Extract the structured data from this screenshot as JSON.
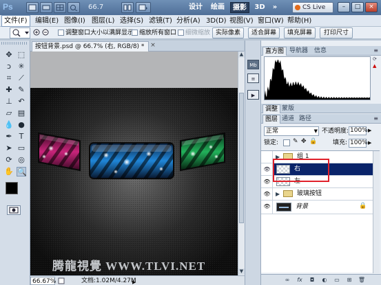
{
  "titlebar": {
    "app_logo": "Ps",
    "zoom_value": "66.7",
    "workspaces": [
      "设计",
      "绘画",
      "摄影",
      "3D"
    ],
    "active_workspace": "摄影",
    "more_label": "»",
    "cs_live": "CS Live",
    "win_minimize": "–",
    "win_restore": "□",
    "win_close": "×"
  },
  "menu": [
    "文件(F)",
    "编辑(E)",
    "图像(I)",
    "图层(L)",
    "选择(S)",
    "滤镜(T)",
    "分析(A)",
    "3D(D)",
    "视图(V)",
    "窗口(W)",
    "帮助(H)"
  ],
  "options": {
    "resize_windows": "调整窗口大小以满屏显示",
    "zoom_all": "缩放所有窗口",
    "scrubby_zoom": "细微缩放",
    "actual_pixels": "实际像素",
    "fit_screen": "适合屏幕",
    "fill_screen": "填充屏幕",
    "print_size": "打印尺寸"
  },
  "document": {
    "tab_title": "按钮背景.psd @ 66.7% (右, RGB/8) *",
    "close": "×",
    "watermark": "腾龍視覺 WWW.TLVI.NET"
  },
  "status": {
    "zoom": "66.67%",
    "doc_info": "文档:1.02M/4.27M"
  },
  "panels": {
    "top_tabs": [
      "直方图",
      "导航器",
      "信息"
    ],
    "mid_tabs": [
      "调整",
      "蒙版"
    ],
    "layer_tabs": [
      "图层",
      "通道",
      "路径"
    ],
    "blend_mode": "正常",
    "opacity_label": "不透明度:",
    "opacity_value": "100%",
    "lock_label": "锁定:",
    "fill_label": "填充:",
    "fill_value": "100%",
    "layers": [
      {
        "name": "组 1",
        "kind": "group",
        "visible": false,
        "selected": false
      },
      {
        "name": "右",
        "kind": "layer",
        "visible": true,
        "selected": true
      },
      {
        "name": "左",
        "kind": "layer",
        "visible": true,
        "selected": false
      },
      {
        "name": "玻璃按钮",
        "kind": "group",
        "visible": true,
        "selected": false
      },
      {
        "name": "背景",
        "kind": "background",
        "visible": true,
        "selected": false,
        "locked": true
      }
    ]
  },
  "colors": {
    "accent": "#0a246a",
    "highlight_box": "#e0202a",
    "pink": "#e2368f",
    "blue": "#2fa6ec",
    "green": "#2fc56a"
  }
}
